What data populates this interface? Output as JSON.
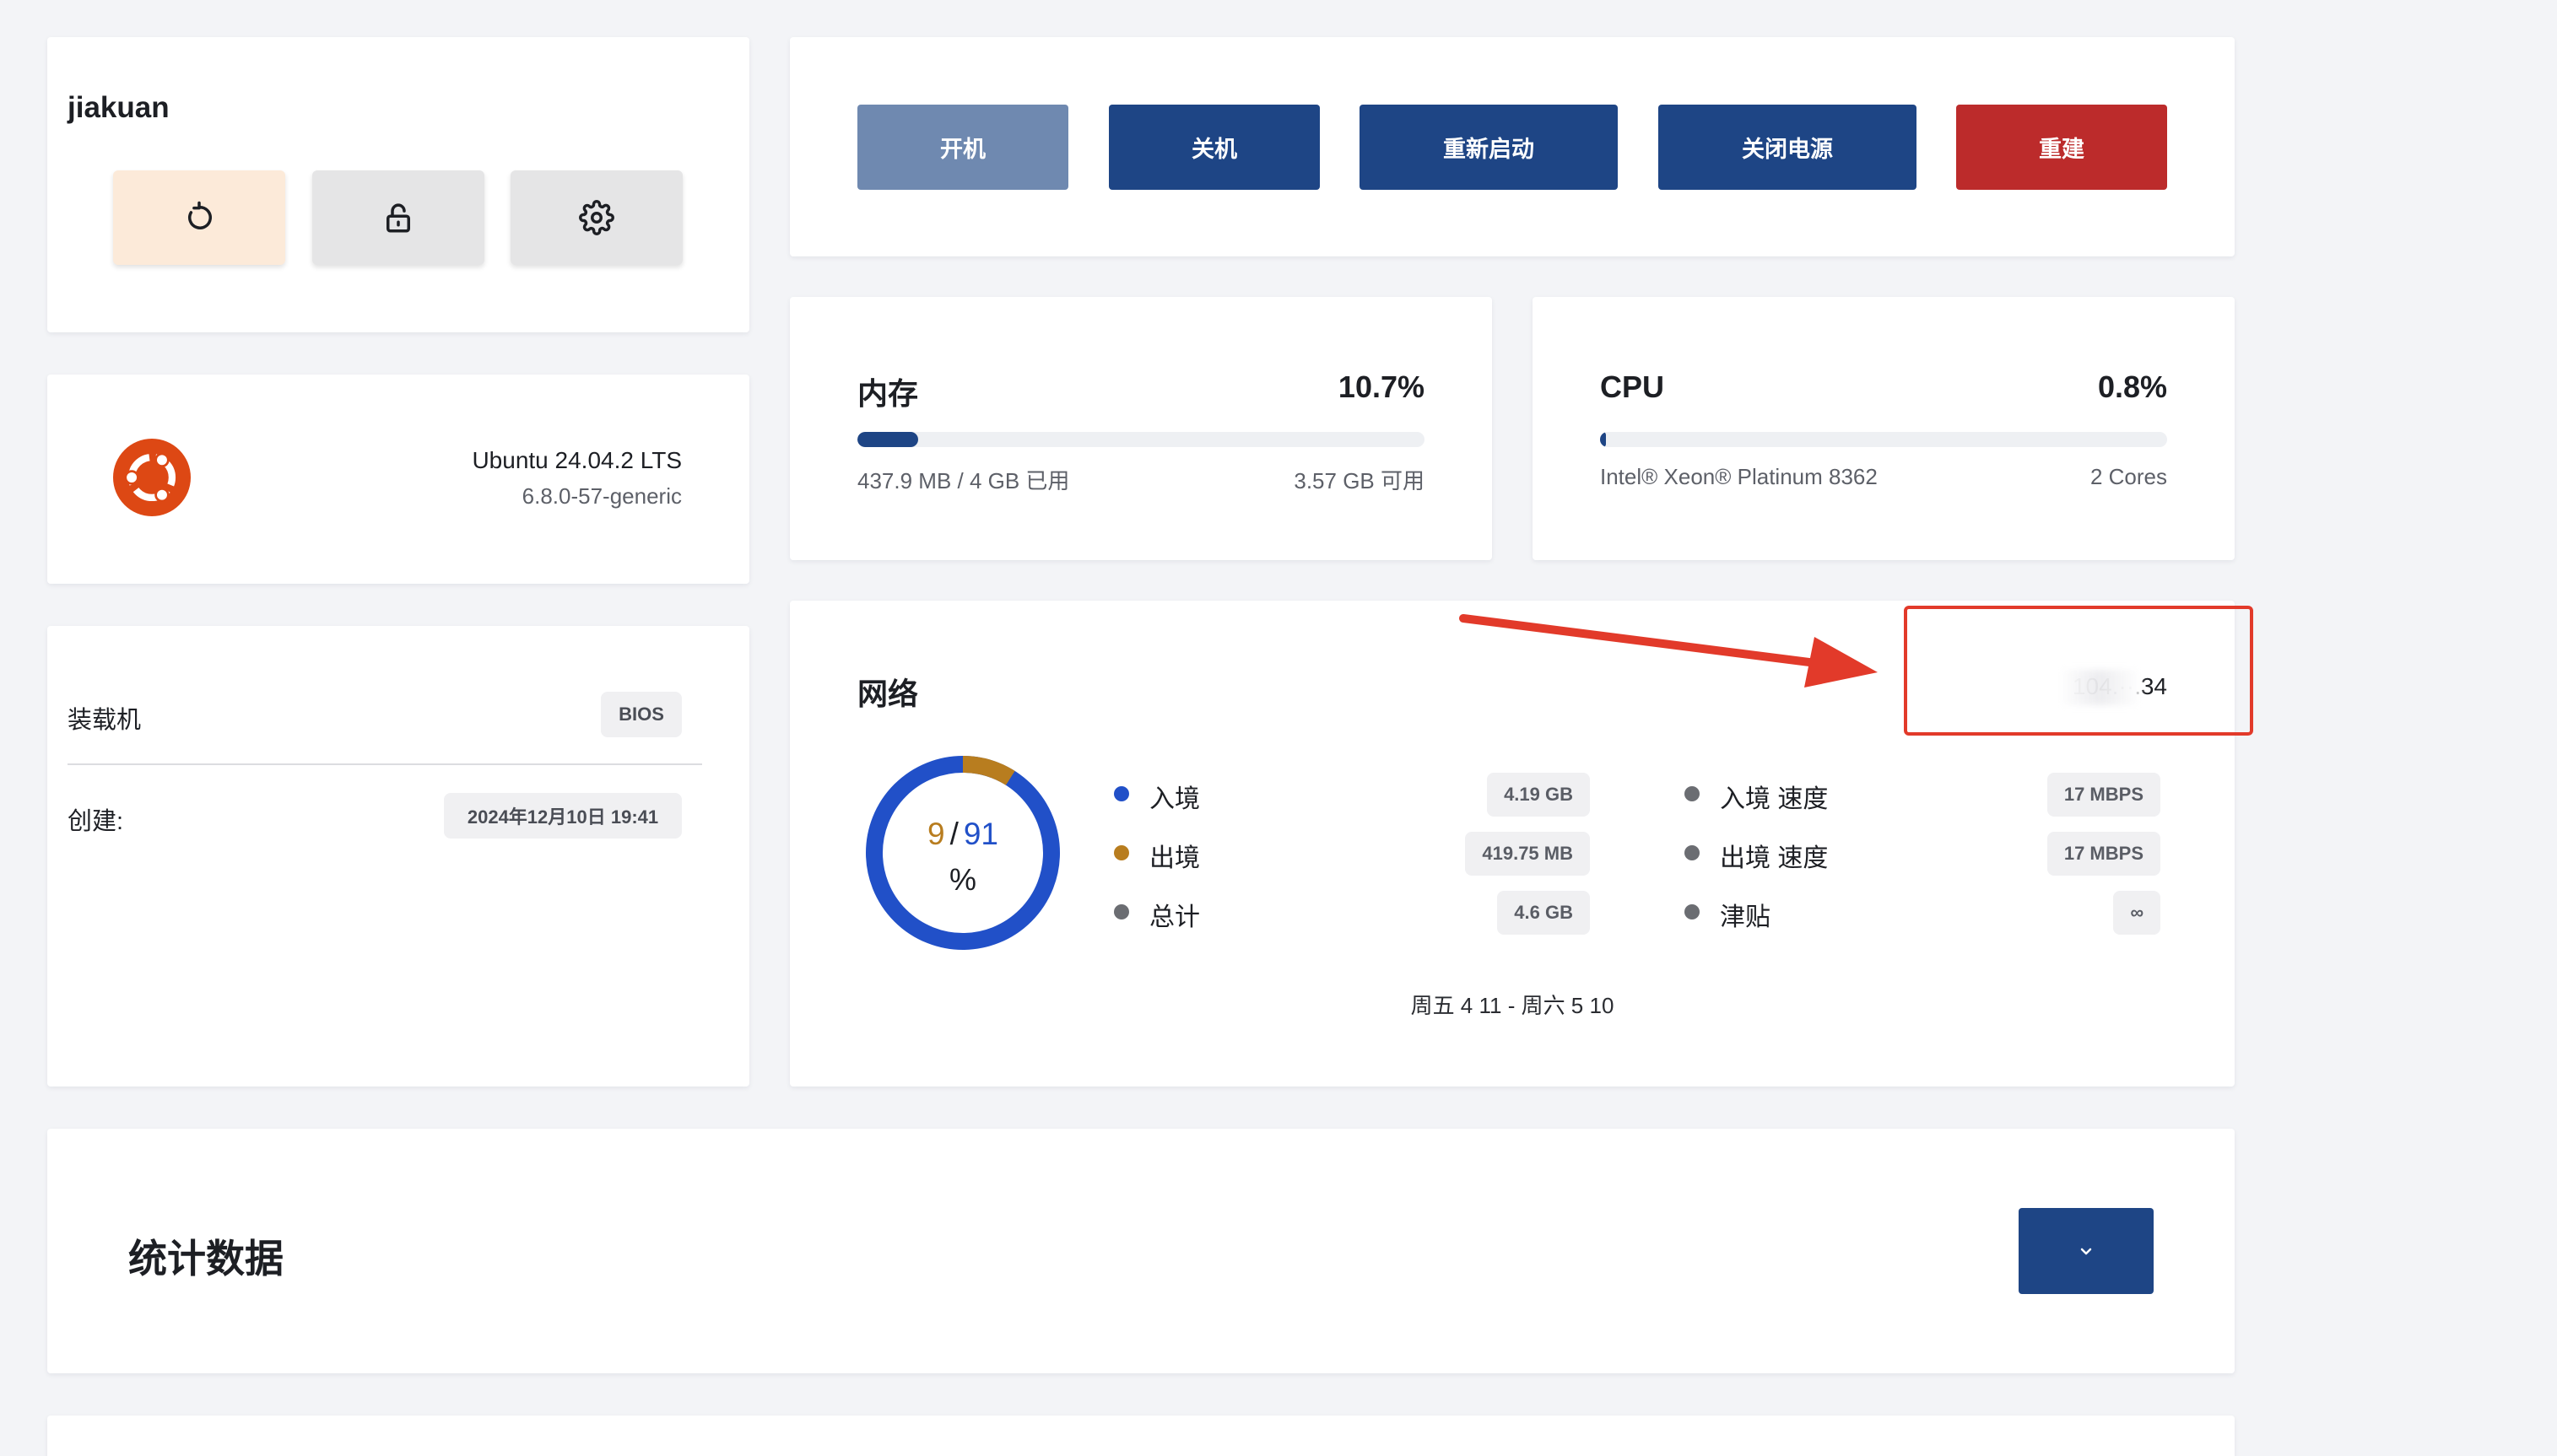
{
  "profile": {
    "username": "jiakuan",
    "actions": [
      {
        "icon": "refresh-icon"
      },
      {
        "icon": "unlock-icon"
      },
      {
        "icon": "gear-icon"
      }
    ]
  },
  "os": {
    "logo_icon": "ubuntu-logo-icon",
    "name": "Ubuntu 24.04.2 LTS",
    "kernel": "6.8.0-57-generic"
  },
  "info": {
    "loader_label": "装载机",
    "loader_value": "BIOS",
    "created_label": "创建:",
    "created_value": "2024年12月10日 19:41"
  },
  "power": {
    "start": "开机",
    "shutdown": "关机",
    "restart": "重新启动",
    "power_off": "关闭电源",
    "rebuild": "重建"
  },
  "memory": {
    "title": "内存",
    "percent": "10.7%",
    "used_fraction": 0.107,
    "used_text": "437.9 MB / 4 GB 已用",
    "available_text": "3.57 GB 可用"
  },
  "cpu": {
    "title": "CPU",
    "percent": "0.8%",
    "used_fraction": 0.008,
    "model": "Intel® Xeon® Platinum 8362",
    "cores": "2 Cores"
  },
  "network": {
    "title": "网络",
    "ip_visible": "104.··.34",
    "donut": {
      "left": "9",
      "sep": "/",
      "right": "91",
      "unit": "%",
      "out_fraction": 0.09,
      "in_color": "#2150c8",
      "out_color": "#b87d1f"
    },
    "left_stats": [
      {
        "label": "入境",
        "value": "4.19 GB",
        "color": "#2150c8"
      },
      {
        "label": "出境",
        "value": "419.75 MB",
        "color": "#b87d1f"
      },
      {
        "label": "总计",
        "value": "4.6 GB",
        "color": "#6b6d72"
      }
    ],
    "right_stats": [
      {
        "label": "入境 速度",
        "value": "17 MBPS",
        "color": "#6b6d72"
      },
      {
        "label": "出境 速度",
        "value": "17 MBPS",
        "color": "#6b6d72"
      },
      {
        "label": "津贴",
        "value": "∞",
        "color": "#6b6d72"
      }
    ],
    "date_range": "周五 4 11 - 周六 5 10"
  },
  "statistics": {
    "title": "统计数据",
    "toggle_icon": "chevron-down-icon"
  }
}
